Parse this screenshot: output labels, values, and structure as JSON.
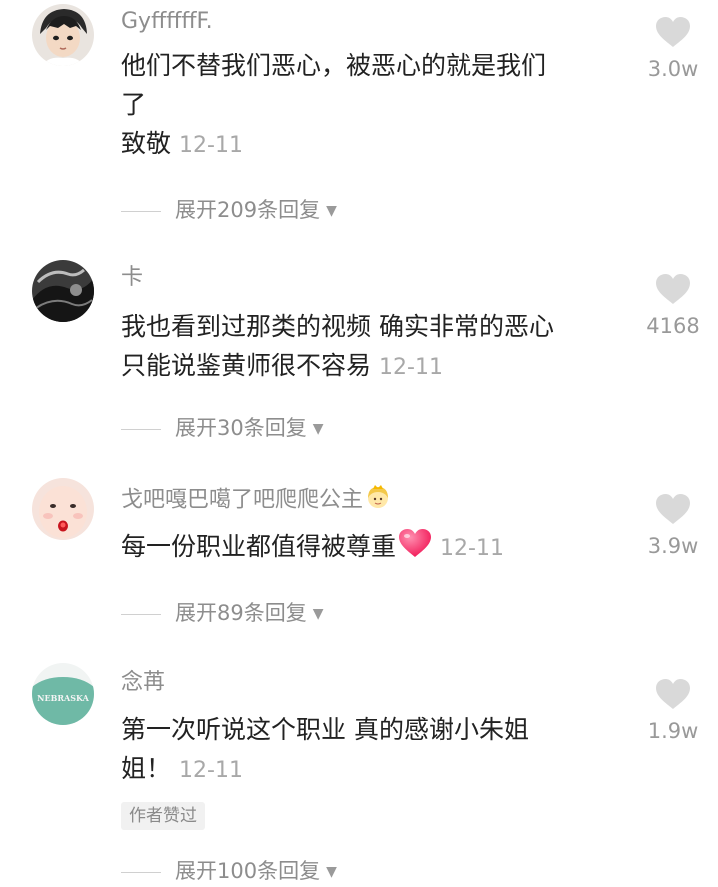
{
  "comments": [
    {
      "username": "GyffffffF.",
      "text_lines": [
        "他们不替我们恶心，被恶心的就是我们",
        "了",
        "致敬"
      ],
      "date": "12-11",
      "likes": "3.0w",
      "replies": "展开209条回复"
    },
    {
      "username": "卡",
      "text_lines": [
        "我也看到过那类的视频 确实非常的恶心",
        "只能说鉴黄师很不容易"
      ],
      "date": "12-11",
      "likes": "4168",
      "replies": "展开30条回复"
    },
    {
      "username": "戈吧嘎巴噶了吧爬爬公主",
      "text_lines": [
        "每一份职业都值得被尊重"
      ],
      "date": "12-11",
      "likes": "3.9w",
      "replies": "展开89条回复"
    },
    {
      "username": "念苒",
      "text_lines": [
        "第一次听说这个职业 真的感谢小朱姐",
        "姐！"
      ],
      "date": "12-11",
      "likes": "1.9w",
      "badge": "作者赞过",
      "replies": "展开100条回复"
    }
  ],
  "avatars": {
    "c4_shirt_text": "NEBRASKA"
  },
  "colors": {
    "heart_outline": "#d6d6d6",
    "emoji_heart": "#ff3d6e"
  },
  "icons": [
    "like-heart-icon",
    "caret-down-icon",
    "princess-emoji-icon",
    "red-heart-emoji-icon"
  ]
}
